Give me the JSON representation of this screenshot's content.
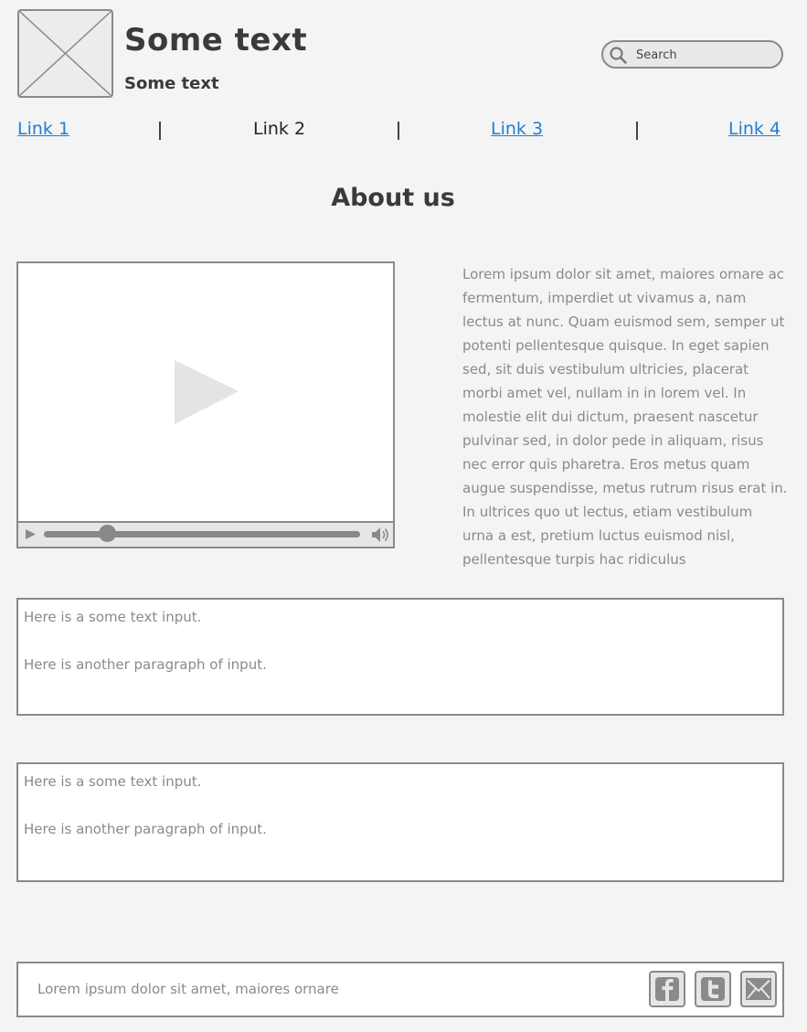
{
  "header": {
    "title": "Some text",
    "subtitle": "Some text",
    "logo_icon": "image-placeholder-icon"
  },
  "search": {
    "placeholder": "Search",
    "value": "",
    "icon": "search-icon"
  },
  "nav": {
    "links": [
      {
        "label": "Link 1",
        "current": false
      },
      {
        "label": "Link 2",
        "current": true
      },
      {
        "label": "Link 3",
        "current": false
      },
      {
        "label": "Link 4",
        "current": false
      }
    ]
  },
  "page": {
    "heading": "About us"
  },
  "video": {
    "progress": 0.2,
    "icons": [
      "play-icon",
      "volume-icon"
    ]
  },
  "about": {
    "text": "Lorem ipsum dolor sit amet, maiores ornare ac fermentum, imperdiet ut vivamus a, nam lectus at nunc. Quam euismod sem, semper ut potenti pellentesque quisque. In eget sapien sed, sit duis vestibulum ultricies, placerat morbi amet vel, nullam in in lorem vel. In molestie elit dui dictum, praesent nascetur pulvinar sed, in dolor pede in aliquam, risus nec error quis pharetra. Eros metus quam augue suspendisse, metus rutrum risus erat in.  In ultrices quo ut lectus, etiam vestibulum urna a est, pretium luctus euismod nisl, pellentesque turpis hac ridiculus"
  },
  "text_boxes": [
    {
      "paragraphs": [
        "Here is a some text input.",
        "Here is another paragraph of input."
      ]
    },
    {
      "paragraphs": [
        "Here is a some text input.",
        "Here is another paragraph of input."
      ]
    }
  ],
  "footer": {
    "text": "Lorem ipsum dolor sit amet, maiores ornare",
    "social_icons": [
      "facebook-icon",
      "twitter-icon",
      "email-icon"
    ]
  },
  "colors": {
    "background": "#f4f4f4",
    "border": "#8a8a8a",
    "link": "#1f7fd2",
    "heading": "#3a3a3a",
    "muted_text": "#8a8a8a"
  }
}
